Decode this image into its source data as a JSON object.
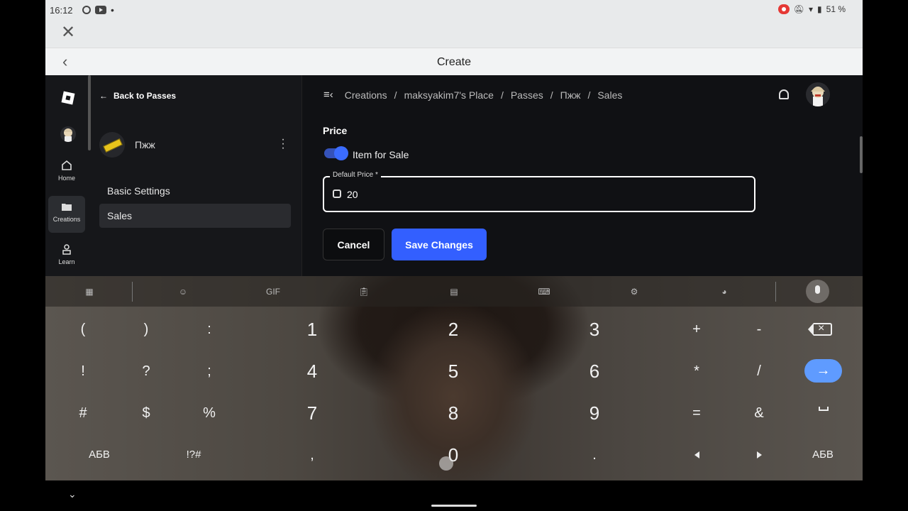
{
  "status": {
    "time": "16:12",
    "battery": "51 %"
  },
  "webview": {
    "title": "Create"
  },
  "rail": [
    {
      "label": "Home"
    },
    {
      "label": "Creations"
    },
    {
      "label": "Learn"
    }
  ],
  "sidebar": {
    "back_label": "Back to Passes",
    "pass_name": "Пжж",
    "items": [
      {
        "label": "Basic Settings"
      },
      {
        "label": "Sales"
      }
    ]
  },
  "breadcrumb": [
    "Creations",
    "/",
    "maksyakim7's Place",
    "/",
    "Passes",
    "/",
    "Пжж",
    "/",
    "Sales"
  ],
  "price": {
    "heading": "Price",
    "toggle_label": "Item for Sale",
    "field_label": "Default Price *",
    "value": "20"
  },
  "buttons": {
    "cancel": "Cancel",
    "save": "Save Changes"
  },
  "keyboard": {
    "toolbar_gif": "GIF",
    "rows": [
      [
        "(",
        ")",
        ":",
        "1",
        "2",
        "3",
        "+",
        "-"
      ],
      [
        "!",
        "?",
        ";",
        "4",
        "5",
        "6",
        "*",
        "/"
      ],
      [
        "#",
        "$",
        "%",
        "7",
        "8",
        "9",
        "=",
        "&"
      ],
      [
        "АБВ",
        "!?#",
        ",",
        "0",
        ".",
        "АБВ"
      ]
    ]
  },
  "colors": {
    "accent": "#335fff",
    "toggle": "#3b6cff",
    "enter_key": "#5f9bff"
  }
}
